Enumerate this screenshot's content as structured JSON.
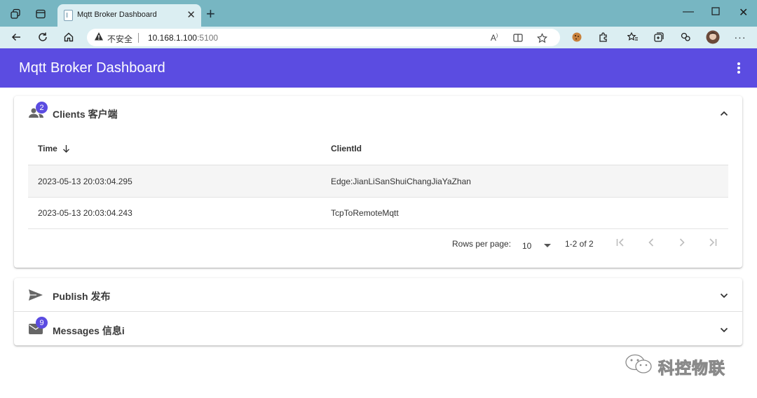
{
  "browser": {
    "tab_title": "Mqtt Broker Dashboard",
    "insecure_label": "不安全",
    "url_host": "10.168.1.100",
    "url_port": ":5100"
  },
  "appbar": {
    "title": "Mqtt Broker Dashboard"
  },
  "clients": {
    "badge": "2",
    "title": "Clients 客户端",
    "columns": {
      "time": "Time",
      "client_id": "ClientId"
    },
    "rows": [
      {
        "time": "2023-05-13 20:03:04.295",
        "client_id": "Edge:JianLiSanShuiChangJiaYaZhan"
      },
      {
        "time": "2023-05-13 20:03:04.243",
        "client_id": "TcpToRemoteMqtt"
      }
    ],
    "pager": {
      "rows_per_page_label": "Rows per page:",
      "rows_per_page": "10",
      "range": "1-2 of 2"
    }
  },
  "publish": {
    "title": "Publish 发布"
  },
  "messages": {
    "badge": "9",
    "title": "Messages 信息i"
  },
  "watermark": {
    "text": "科控物联"
  },
  "colors": {
    "accent": "#5b4ce1",
    "titlebar": "#77b6c2",
    "toolbar": "#dbeef2"
  }
}
